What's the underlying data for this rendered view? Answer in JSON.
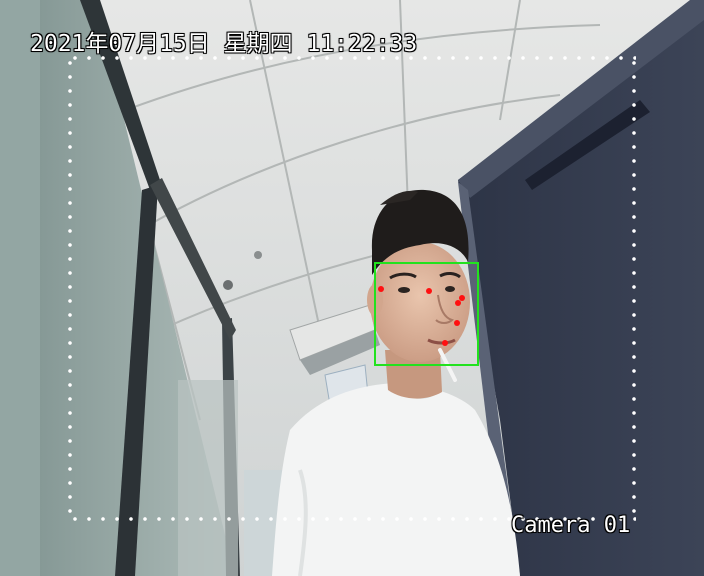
{
  "osd": {
    "timestamp": "2021年07月15日 星期四 11:22:33",
    "camera_name": "Camera 01"
  },
  "detection": {
    "box_color": "#22e21e",
    "landmark_color": "#ff1010",
    "landmark_count": 5
  },
  "roi": {
    "dot_color": "#ffffff"
  }
}
